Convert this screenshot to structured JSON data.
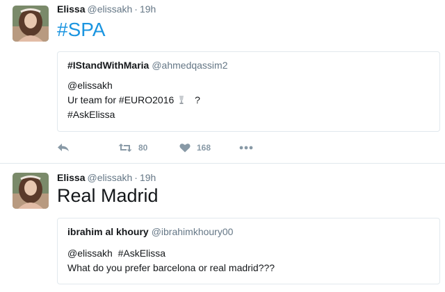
{
  "tweets": [
    {
      "author": {
        "name": "Elissa",
        "handle": "@elissakh"
      },
      "separator": "·",
      "time": "19h",
      "text": "#SPA",
      "quote": {
        "name": "#IStandWithMaria",
        "handle": "@ahmedqassim2",
        "lines": [
          "@elissakh",
          "Ur team for #EURO2016",
          "?",
          "#AskElissa"
        ]
      },
      "actions": {
        "reply_icon": "reply-icon",
        "retweet_icon": "retweet-icon",
        "retweet_count": "80",
        "like_icon": "heart-icon",
        "like_count": "168",
        "more_icon": "more-icon"
      }
    },
    {
      "author": {
        "name": "Elissa",
        "handle": "@elissakh"
      },
      "separator": "·",
      "time": "19h",
      "text": "Real Madrid",
      "quote": {
        "name": "ibrahim al khoury",
        "handle": "@ibrahimkhoury00",
        "lines": [
          "@elissakh  #AskElissa",
          "What do you prefer barcelona or real madrid???"
        ]
      }
    }
  ],
  "colors": {
    "link": "#1b95e0",
    "muted": "#657786",
    "border": "#e1e8ed",
    "icon": "#8899a6"
  }
}
